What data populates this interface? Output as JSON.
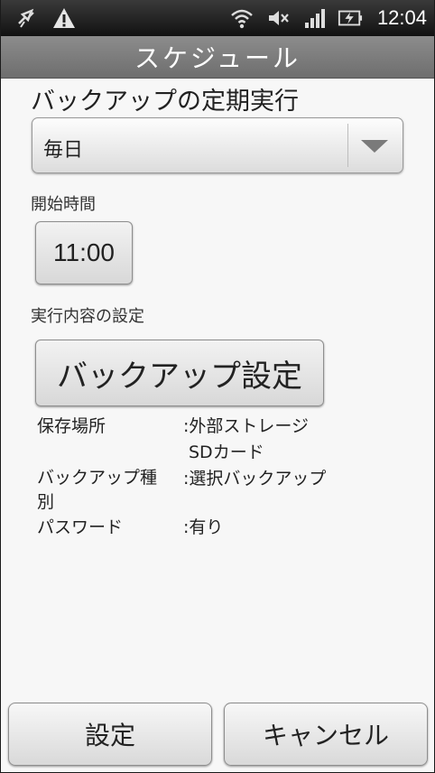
{
  "status_bar": {
    "icons_left": [
      "sync-icon",
      "warning-icon"
    ],
    "icons_right": [
      "wifi-icon",
      "mute-icon",
      "signal-icon",
      "battery-charging-icon"
    ],
    "time": "12:04"
  },
  "header": {
    "title": "スケジュール"
  },
  "schedule": {
    "heading": "バックアップの定期実行",
    "frequency_selected": "毎日",
    "start_time_label": "開始時間",
    "start_time_value": "11:00",
    "content_label": "実行内容の設定",
    "backup_settings_button": "バックアップ設定"
  },
  "info": [
    {
      "key": "保存場所",
      "value": ":外部ストレージ"
    },
    {
      "key": "",
      "value": "SDカード"
    },
    {
      "key": "バックアップ種別",
      "value": ":選択バックアップ"
    },
    {
      "key": "パスワード",
      "value": ":有り"
    }
  ],
  "footer": {
    "ok_label": "設定",
    "cancel_label": "キャンセル"
  },
  "colors": {
    "status_bar": "#1a1a1a",
    "title_bar": "#7d7d7d",
    "background": "#f7f7f7"
  }
}
